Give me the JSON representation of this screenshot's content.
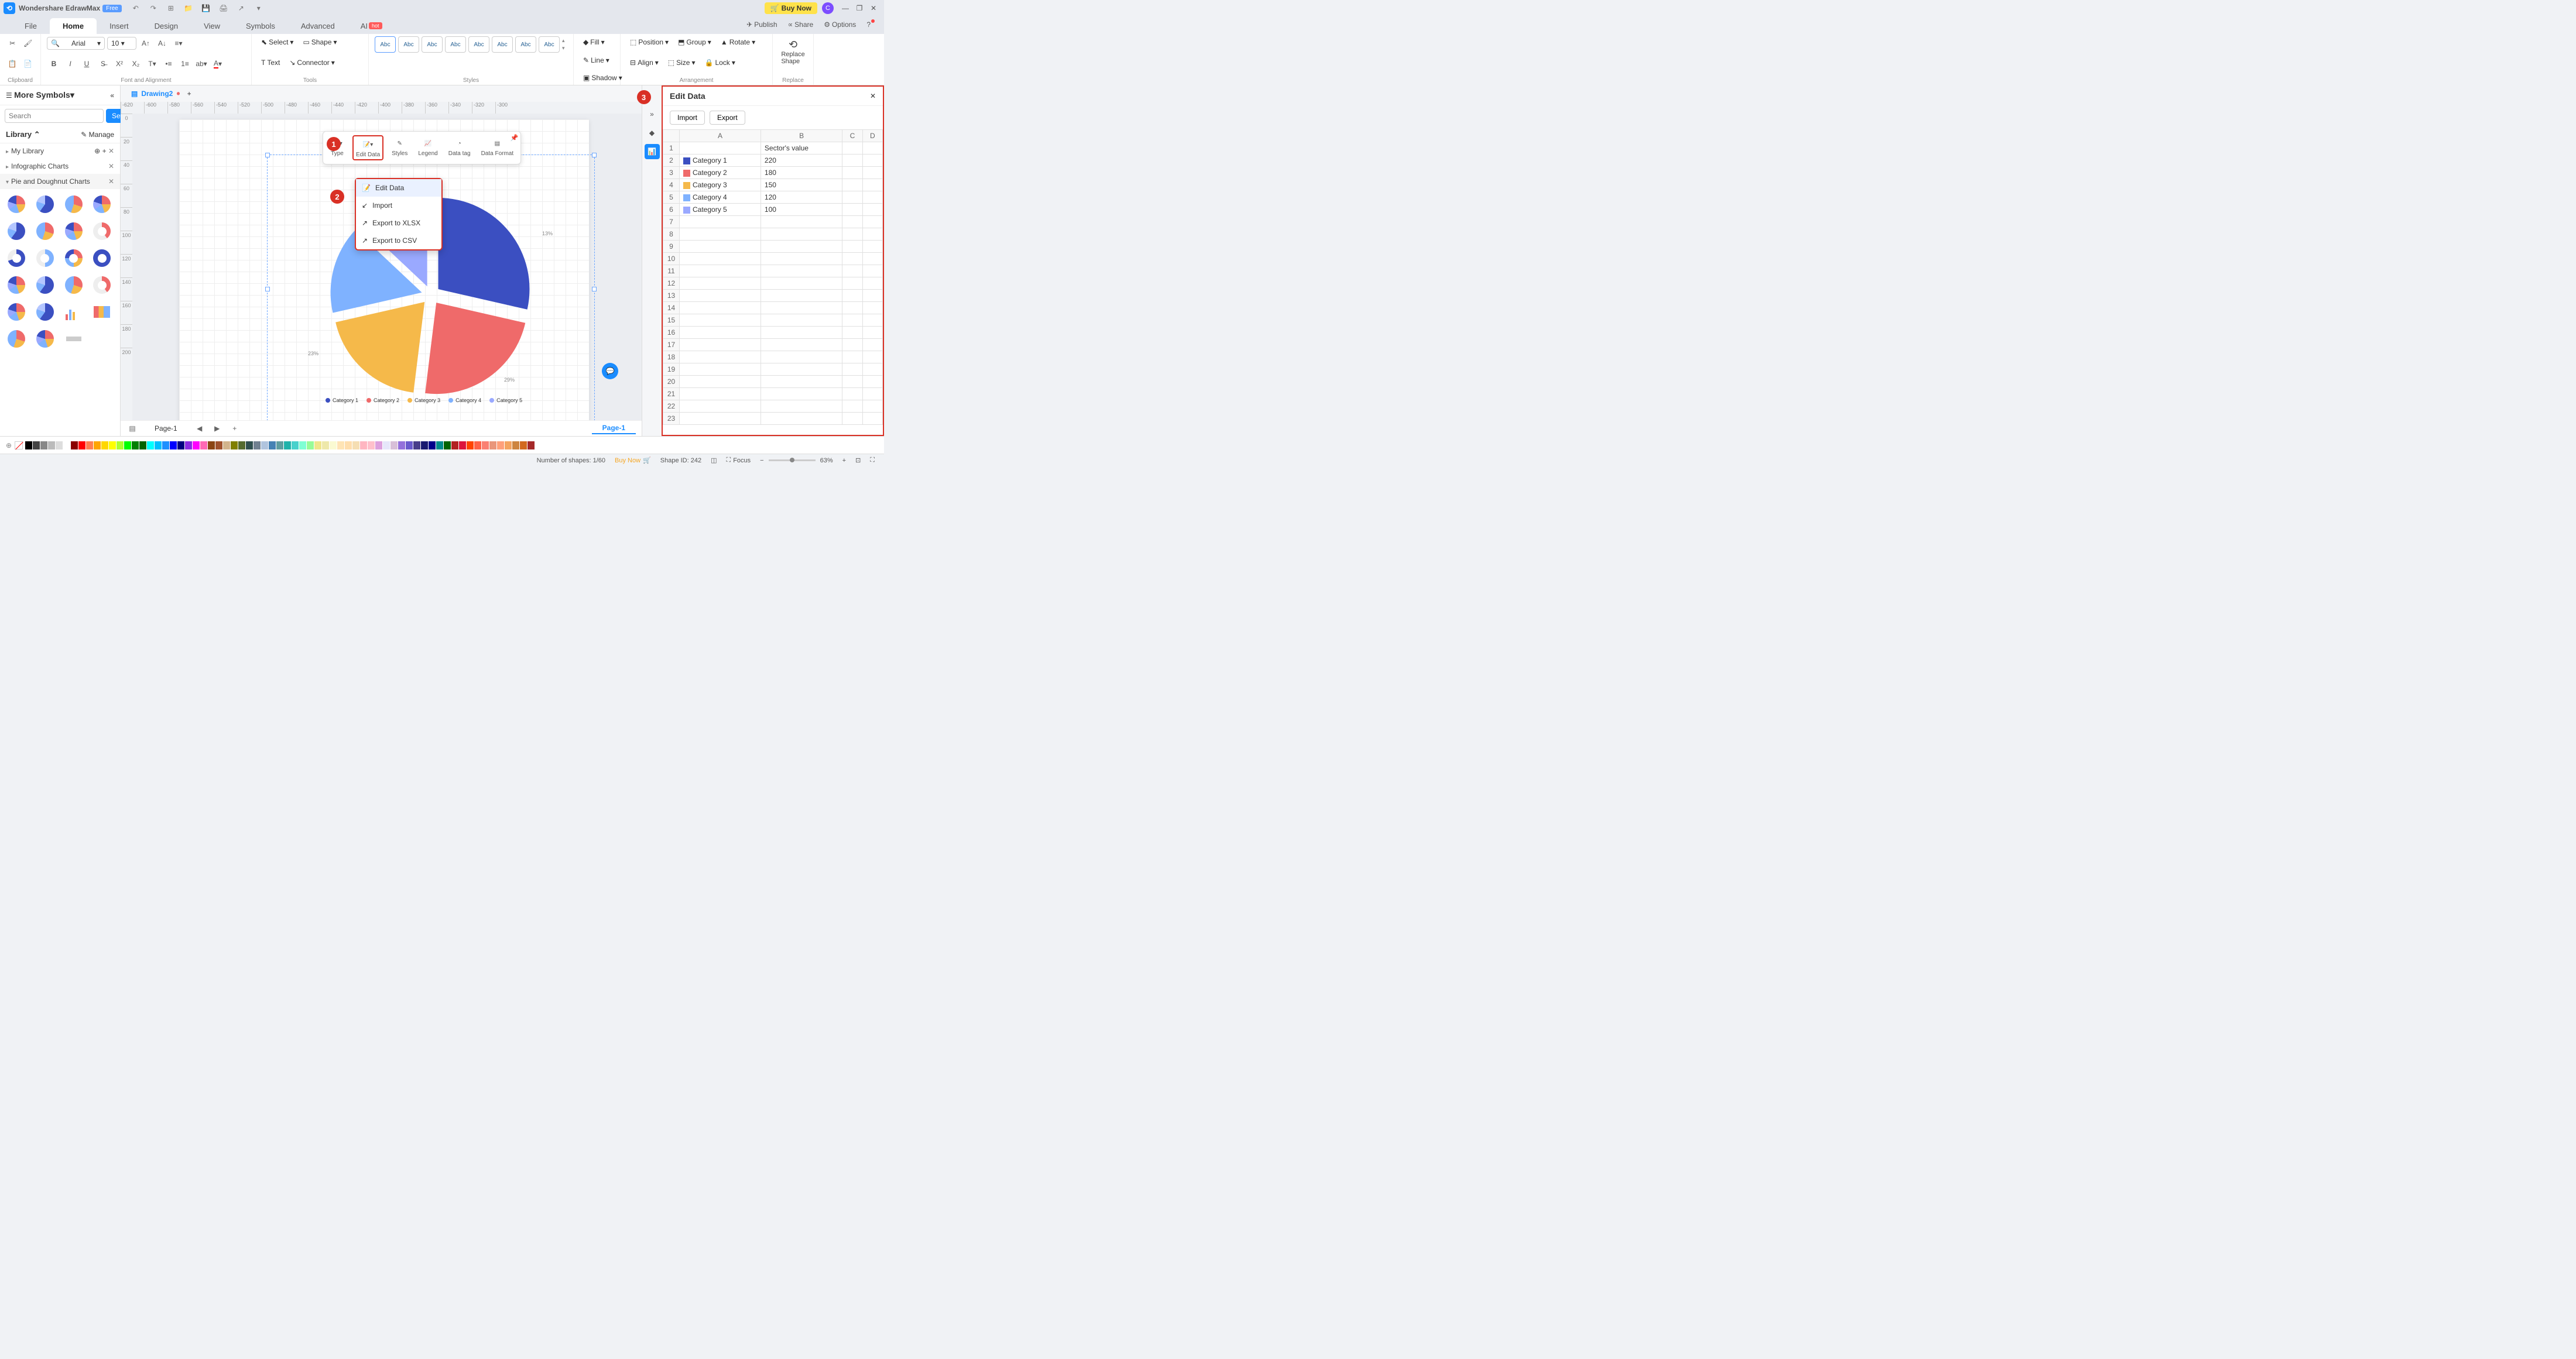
{
  "titlebar": {
    "app_name": "Wondershare EdrawMax",
    "free_label": "Free",
    "buy_now": "Buy Now",
    "avatar_letter": "C"
  },
  "menu": {
    "file": "File",
    "home": "Home",
    "insert": "Insert",
    "design": "Design",
    "view": "View",
    "symbols": "Symbols",
    "advanced": "Advanced",
    "ai": "AI",
    "hot": "hot",
    "publish": "Publish",
    "share": "Share",
    "options": "Options"
  },
  "ribbon": {
    "clipboard": "Clipboard",
    "font_name": "Arial",
    "font_size": "10",
    "font_align": "Font and Alignment",
    "select": "Select",
    "text": "Text",
    "shape": "Shape",
    "connector": "Connector",
    "tools": "Tools",
    "style_label": "Abc",
    "styles": "Styles",
    "fill": "Fill",
    "line": "Line",
    "shadow": "Shadow",
    "position": "Position",
    "align": "Align",
    "group": "Group",
    "size": "Size",
    "rotate": "Rotate",
    "lock": "Lock",
    "arrangement": "Arrangement",
    "replace_shape": "Replace Shape",
    "replace": "Replace"
  },
  "left": {
    "more_symbols": "More Symbols",
    "search_placeholder": "Search",
    "search_btn": "Search",
    "library": "Library",
    "manage": "Manage",
    "my_library": "My Library",
    "infographic": "Infographic Charts",
    "pie": "Pie and Doughnut Charts"
  },
  "doc": {
    "tab_name": "Drawing2"
  },
  "ruler_h": [
    "-620",
    "-600",
    "-580",
    "-560",
    "-540",
    "-520",
    "-500",
    "-480",
    "-460",
    "-440",
    "-420",
    "-400",
    "-380",
    "-360",
    "-340",
    "-320",
    "-300"
  ],
  "ruler_v": [
    "0",
    "20",
    "40",
    "60",
    "80",
    "100",
    "120",
    "140",
    "160",
    "180",
    "200"
  ],
  "float_toolbar": {
    "type": "Type",
    "edit_data": "Edit Data",
    "styles": "Styles",
    "legend": "Legend",
    "data_tag": "Data tag",
    "data_format": "Data Format"
  },
  "dropdown": {
    "edit_data": "Edit Data",
    "import": "Import",
    "export_xlsx": "Export to XLSX",
    "export_csv": "Export to CSV"
  },
  "pct_13": "13%",
  "pct_23": "23%",
  "pct_29": "29%",
  "edit_panel": {
    "title": "Edit Data",
    "import": "Import",
    "export": "Export",
    "col_a": "A",
    "col_b": "B",
    "col_c": "C",
    "col_d": "D",
    "header_b": "Sector's value"
  },
  "chart_data": {
    "type": "pie",
    "title": "",
    "categories": [
      "Category 1",
      "Category 2",
      "Category 3",
      "Category 4",
      "Category 5"
    ],
    "values": [
      220,
      180,
      150,
      120,
      100
    ],
    "colors": [
      "#3b4fc1",
      "#ef6a6a",
      "#f5b94a",
      "#7fb2ff",
      "#9aa9ff"
    ],
    "percent_labels": [
      29,
      23,
      null,
      null,
      13
    ]
  },
  "badges": {
    "b1": "1",
    "b2": "2",
    "b3": "3"
  },
  "status": {
    "page": "Page-1",
    "tab_page": "Page-1",
    "shapes": "Number of shapes: 1/60",
    "buy_now": "Buy Now",
    "shape_id": "Shape ID: 242",
    "focus": "Focus",
    "zoom": "63%"
  },
  "color_swatches": [
    "#000",
    "#444",
    "#888",
    "#bbb",
    "#ddd",
    "#fff",
    "#8b0000",
    "#f00",
    "#ff7f50",
    "#ffa500",
    "#ffd700",
    "#ff0",
    "#adff2f",
    "#0f0",
    "#008000",
    "#006400",
    "#0ff",
    "#00bfff",
    "#1e90ff",
    "#00f",
    "#000080",
    "#8a2be2",
    "#f0f",
    "#ff69b4",
    "#8b4513",
    "#a0522d",
    "#d2b48c",
    "#808000",
    "#556b2f",
    "#2f4f4f",
    "#708090",
    "#b0c4de",
    "#4682b4",
    "#5f9ea0",
    "#20b2aa",
    "#48d1cc",
    "#7fffd4",
    "#98fb98",
    "#f0e68c",
    "#eee8aa",
    "#fafad2",
    "#ffe4b5",
    "#ffdead",
    "#f5deb3",
    "#ffb6c1",
    "#ffc0cb",
    "#dda0dd",
    "#e6e6fa",
    "#d8bfd8",
    "#9370db",
    "#6a5acd",
    "#483d8b",
    "#191970",
    "#00008b",
    "#008b8b",
    "#006400",
    "#b22222",
    "#dc143c",
    "#ff4500",
    "#ff6347",
    "#fa8072",
    "#e9967a",
    "#ffa07a",
    "#f4a460",
    "#cd853f",
    "#d2691e",
    "#a52a2a"
  ]
}
